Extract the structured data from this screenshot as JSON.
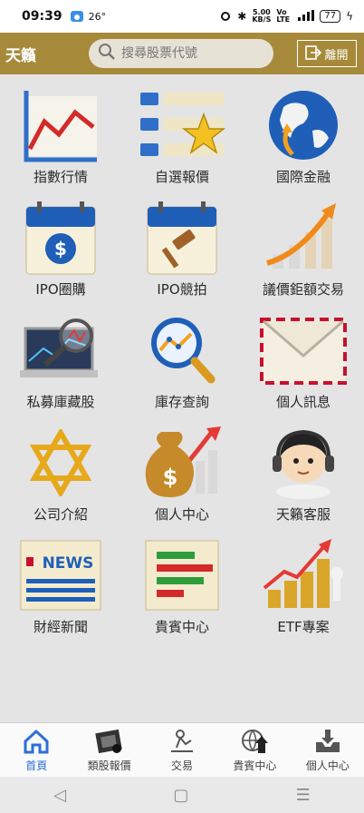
{
  "status": {
    "time": "09:39",
    "temperature": "26°",
    "net_speed": "5.00",
    "net_unit": "KB/S",
    "net_type": "Vo LTE",
    "battery": "77"
  },
  "header": {
    "brand": "天籟",
    "search_placeholder": "搜尋股票代號",
    "logout_label": "離開"
  },
  "menu": [
    {
      "label": "指數行情",
      "icon": "line-chart-icon"
    },
    {
      "label": "自選報價",
      "icon": "star-list-icon"
    },
    {
      "label": "國際金融",
      "icon": "globe-icon"
    },
    {
      "label": "IPO圈購",
      "icon": "calendar-dollar-icon"
    },
    {
      "label": "IPO競拍",
      "icon": "calendar-gavel-icon"
    },
    {
      "label": "議價鉅額交易",
      "icon": "rising-bars-icon"
    },
    {
      "label": "私募庫藏股",
      "icon": "laptop-magnifier-icon"
    },
    {
      "label": "庫存查詢",
      "icon": "magnifier-chart-icon"
    },
    {
      "label": "個人訊息",
      "icon": "envelope-icon"
    },
    {
      "label": "公司介紹",
      "icon": "star-of-david-icon"
    },
    {
      "label": "個人中心",
      "icon": "money-bag-icon"
    },
    {
      "label": "天籟客服",
      "icon": "support-agent-icon"
    },
    {
      "label": "財經新聞",
      "icon": "news-icon"
    },
    {
      "label": "貴賓中心",
      "icon": "bar-list-icon"
    },
    {
      "label": "ETF專案",
      "icon": "coins-chart-icon"
    }
  ],
  "bottom_nav": [
    {
      "label": "首頁",
      "icon": "home-icon",
      "active": true
    },
    {
      "label": "類股報價",
      "icon": "film-quote-icon",
      "active": false
    },
    {
      "label": "交易",
      "icon": "trade-icon",
      "active": false
    },
    {
      "label": "貴賓中心",
      "icon": "globe-upload-icon",
      "active": false
    },
    {
      "label": "個人中心",
      "icon": "inbox-download-icon",
      "active": false
    }
  ],
  "colors": {
    "header": "#a68a3a",
    "active_nav": "#2a6fd6"
  }
}
